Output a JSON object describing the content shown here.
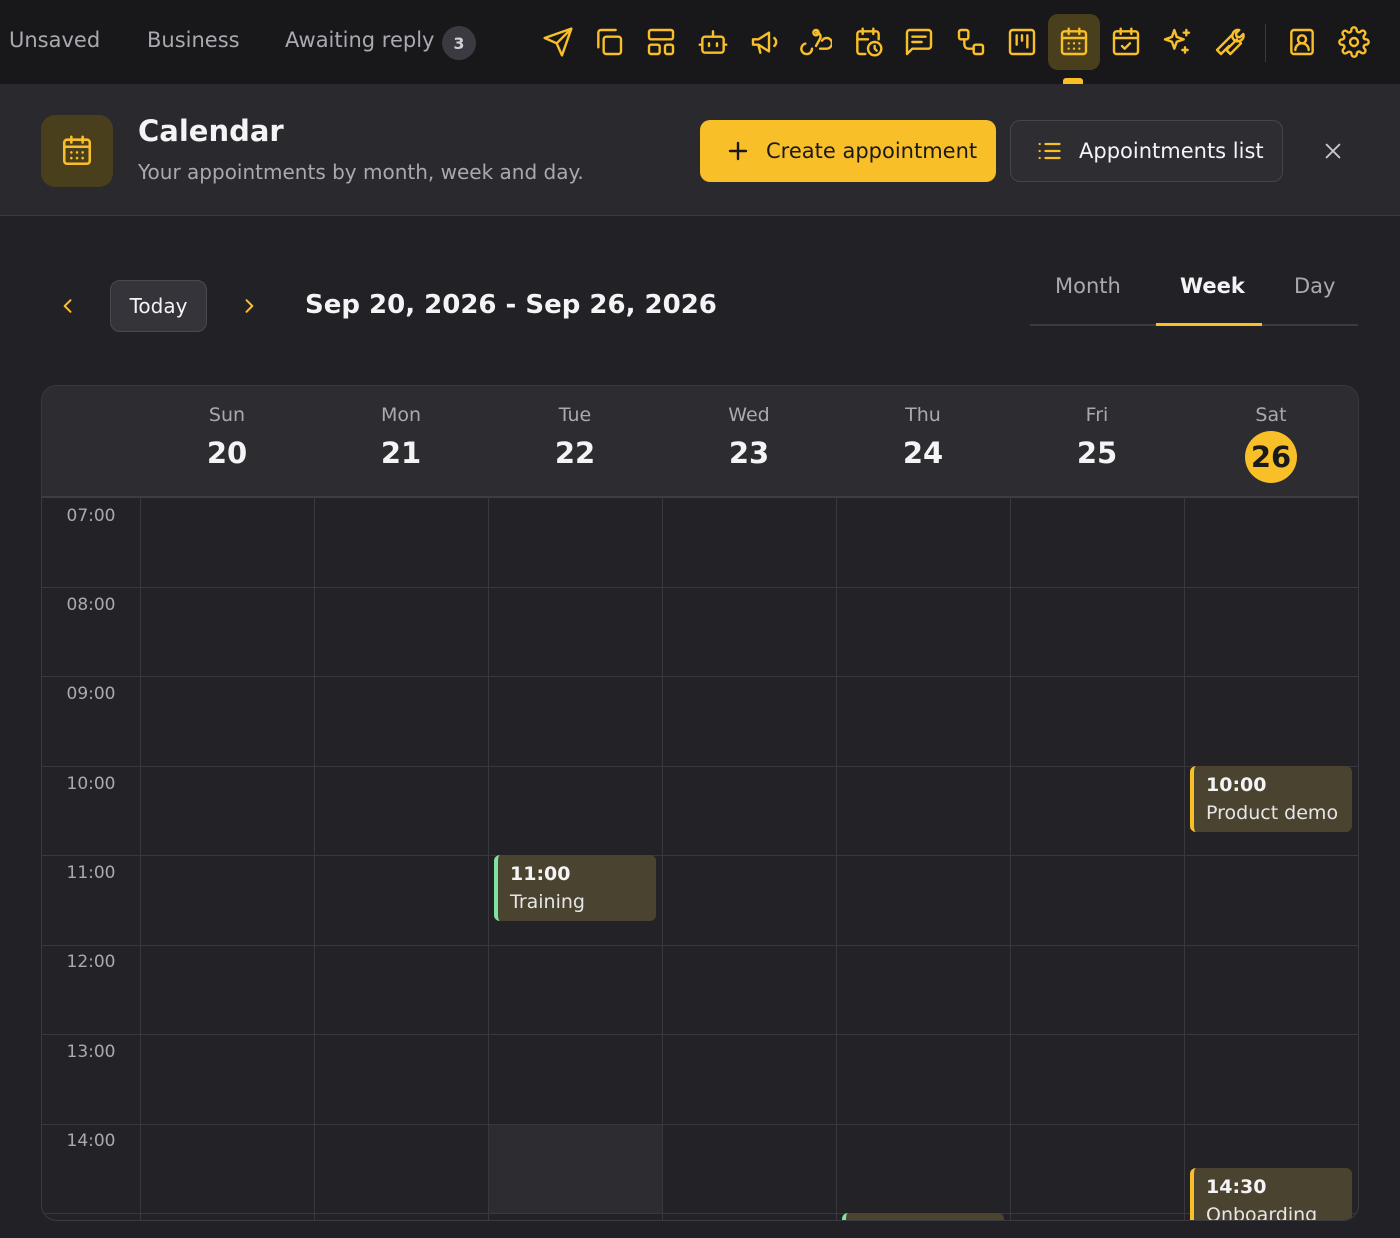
{
  "topbar": {
    "filters": [
      "Unsaved",
      "Business",
      "Awaiting reply"
    ],
    "awaiting_count": "3",
    "icons": [
      "send-icon",
      "copy-icon",
      "layout-icon",
      "bot-icon",
      "megaphone-icon",
      "webhook-icon",
      "calendar-clock-icon",
      "message-icon",
      "flow-icon",
      "kanban-icon",
      "calendar-icon",
      "calendar-check-icon",
      "sparkles-icon",
      "wrench-icon",
      "contact-icon",
      "settings-icon"
    ],
    "active_icon": "calendar-icon"
  },
  "header": {
    "title": "Calendar",
    "subtitle": "Your appointments by month, week and day.",
    "create_label": "Create appointment",
    "list_label": "Appointments list"
  },
  "toolbar": {
    "today_label": "Today",
    "range": "Sep 20, 2026 - Sep 26, 2026",
    "views": [
      "Month",
      "Week",
      "Day"
    ],
    "selected_view": "Week"
  },
  "calendar": {
    "days": [
      {
        "name": "Sun",
        "num": "20"
      },
      {
        "name": "Mon",
        "num": "21"
      },
      {
        "name": "Tue",
        "num": "22"
      },
      {
        "name": "Wed",
        "num": "23"
      },
      {
        "name": "Thu",
        "num": "24"
      },
      {
        "name": "Fri",
        "num": "25"
      },
      {
        "name": "Sat",
        "num": "26"
      }
    ],
    "today_num": "26",
    "hours": [
      "07:00",
      "08:00",
      "09:00",
      "10:00",
      "11:00",
      "12:00",
      "13:00",
      "14:00"
    ],
    "events": [
      {
        "time": "10:00",
        "title": "Product demo",
        "day": "Sat",
        "color": "#f9bf28"
      },
      {
        "time": "11:00",
        "title": "Training",
        "day": "Tue",
        "color": "#7fe3a0"
      },
      {
        "time": "14:30",
        "title": "Onboarding",
        "day": "Sat",
        "color": "#f9bf28"
      }
    ]
  },
  "colors": {
    "accent": "#f9bf28",
    "background": "#222226",
    "event_bg": "#4a4330",
    "event_green": "#7fe3a0"
  }
}
